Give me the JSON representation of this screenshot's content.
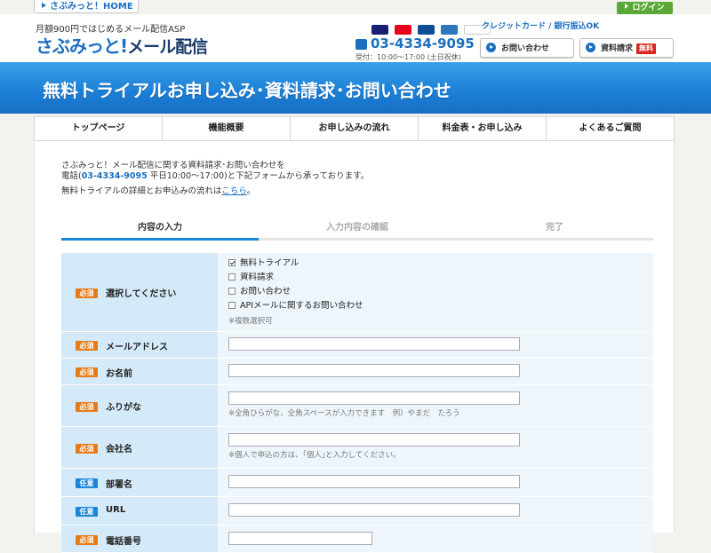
{
  "top": {
    "home_link": "さぶみっと！HOME"
  },
  "header": {
    "tagline": "月額900円ではじめるメール配信ASP",
    "logo_main": "さぶみっと!",
    "logo_sub": "メール配信",
    "payment_text": "クレジットカード / 銀行振込OK",
    "login_label": "ログイン",
    "phone": "03-4334-9095",
    "hours": "受付：10:00～17:00 (土日祝休)",
    "contact_label": "お問い合わせ",
    "request_label": "資料請求",
    "free_label": "無料",
    "card_colors": [
      "#1a1f71",
      "#eb001b",
      "#0e4c96",
      "#2e77bc",
      "#ffffff"
    ]
  },
  "banner": {
    "title": "無料トライアルお申し込み･資料請求･お問い合わせ"
  },
  "nav": {
    "items": [
      "トップページ",
      "機能概要",
      "お申し込みの流れ",
      "料金表・お申し込み",
      "よくあるご質問"
    ]
  },
  "intro": {
    "line1": "さぶみっと！メール配信に関する資料請求･お問い合わせを",
    "line2_prefix": "電話(",
    "line2_tel": "03-4334-9095",
    "line2_suffix": " 平日10:00～17:00)と下記フォームから承っております。",
    "line3_prefix": "無料トライアルの詳細とお申込みの流れは",
    "line3_link": "こちら",
    "line3_suffix": "。"
  },
  "steps": [
    "内容の入力",
    "入力内容の確認",
    "完了"
  ],
  "form": {
    "required_badge": "必須",
    "optional_badge": "任意",
    "select_label": "選択してください",
    "options": [
      "無料トライアル",
      "資料請求",
      "お問い合わせ",
      "APIメールに関するお問い合わせ"
    ],
    "options_checked": [
      true,
      false,
      false,
      false
    ],
    "multi_note": "※複数選択可",
    "email_label": "メールアドレス",
    "name_label": "お名前",
    "furigana_label": "ふりがな",
    "furigana_note": "※全角ひらがな、全角スペースが入力できます　例）やまだ　たろう",
    "company_label": "会社名",
    "company_note": "※個人で申込の方は、｢個人｣と入力してください。",
    "dept_label": "部署名",
    "url_label": "URL",
    "tel_label": "電話番号"
  },
  "colors": {
    "accent": "#1b6fc0",
    "banner": "#1b7ed6",
    "required": "#e67a17",
    "optional": "#1b85d6",
    "login": "#5aa836",
    "free": "#d9241c"
  }
}
